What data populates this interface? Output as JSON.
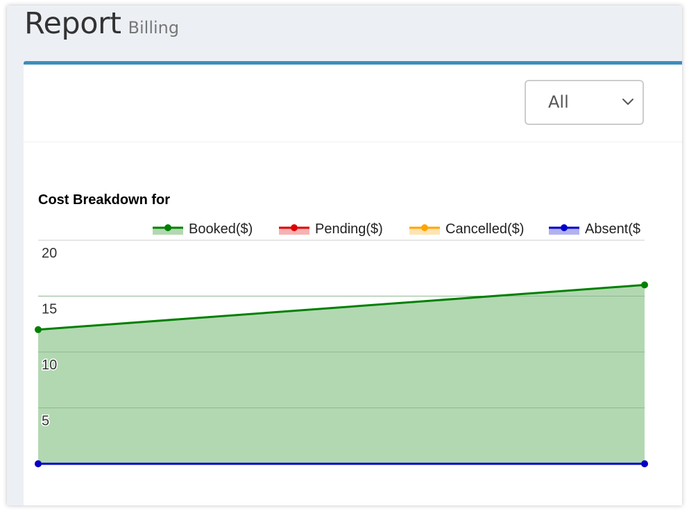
{
  "header": {
    "title": "Report",
    "subtitle": "Billing"
  },
  "filter": {
    "selected": "All",
    "icon": "chevron-down-icon"
  },
  "colors": {
    "accent": "#3c8dbc",
    "booked": "#008000",
    "booked_fill": "#b2d8b2",
    "pending": "#e00000",
    "pending_fill": "#f6b3b3",
    "cancelled": "#ffa500",
    "cancelled_fill": "#ffe4b2",
    "absent": "#0000cc",
    "absent_fill": "#b2b2f0"
  },
  "chart_data": {
    "type": "area",
    "title": "Cost Breakdown for",
    "legend_position": "top",
    "ylim": [
      0,
      20
    ],
    "yticks": [
      5,
      10,
      15,
      20
    ],
    "grid": true,
    "x": [
      0,
      1
    ],
    "series": [
      {
        "name": "Booked($)",
        "values": [
          12,
          16
        ]
      },
      {
        "name": "Pending($)",
        "values": [
          0,
          0
        ]
      },
      {
        "name": "Cancelled($)",
        "values": [
          0,
          0
        ]
      },
      {
        "name": "Absent($",
        "values": [
          0,
          0
        ]
      }
    ]
  }
}
